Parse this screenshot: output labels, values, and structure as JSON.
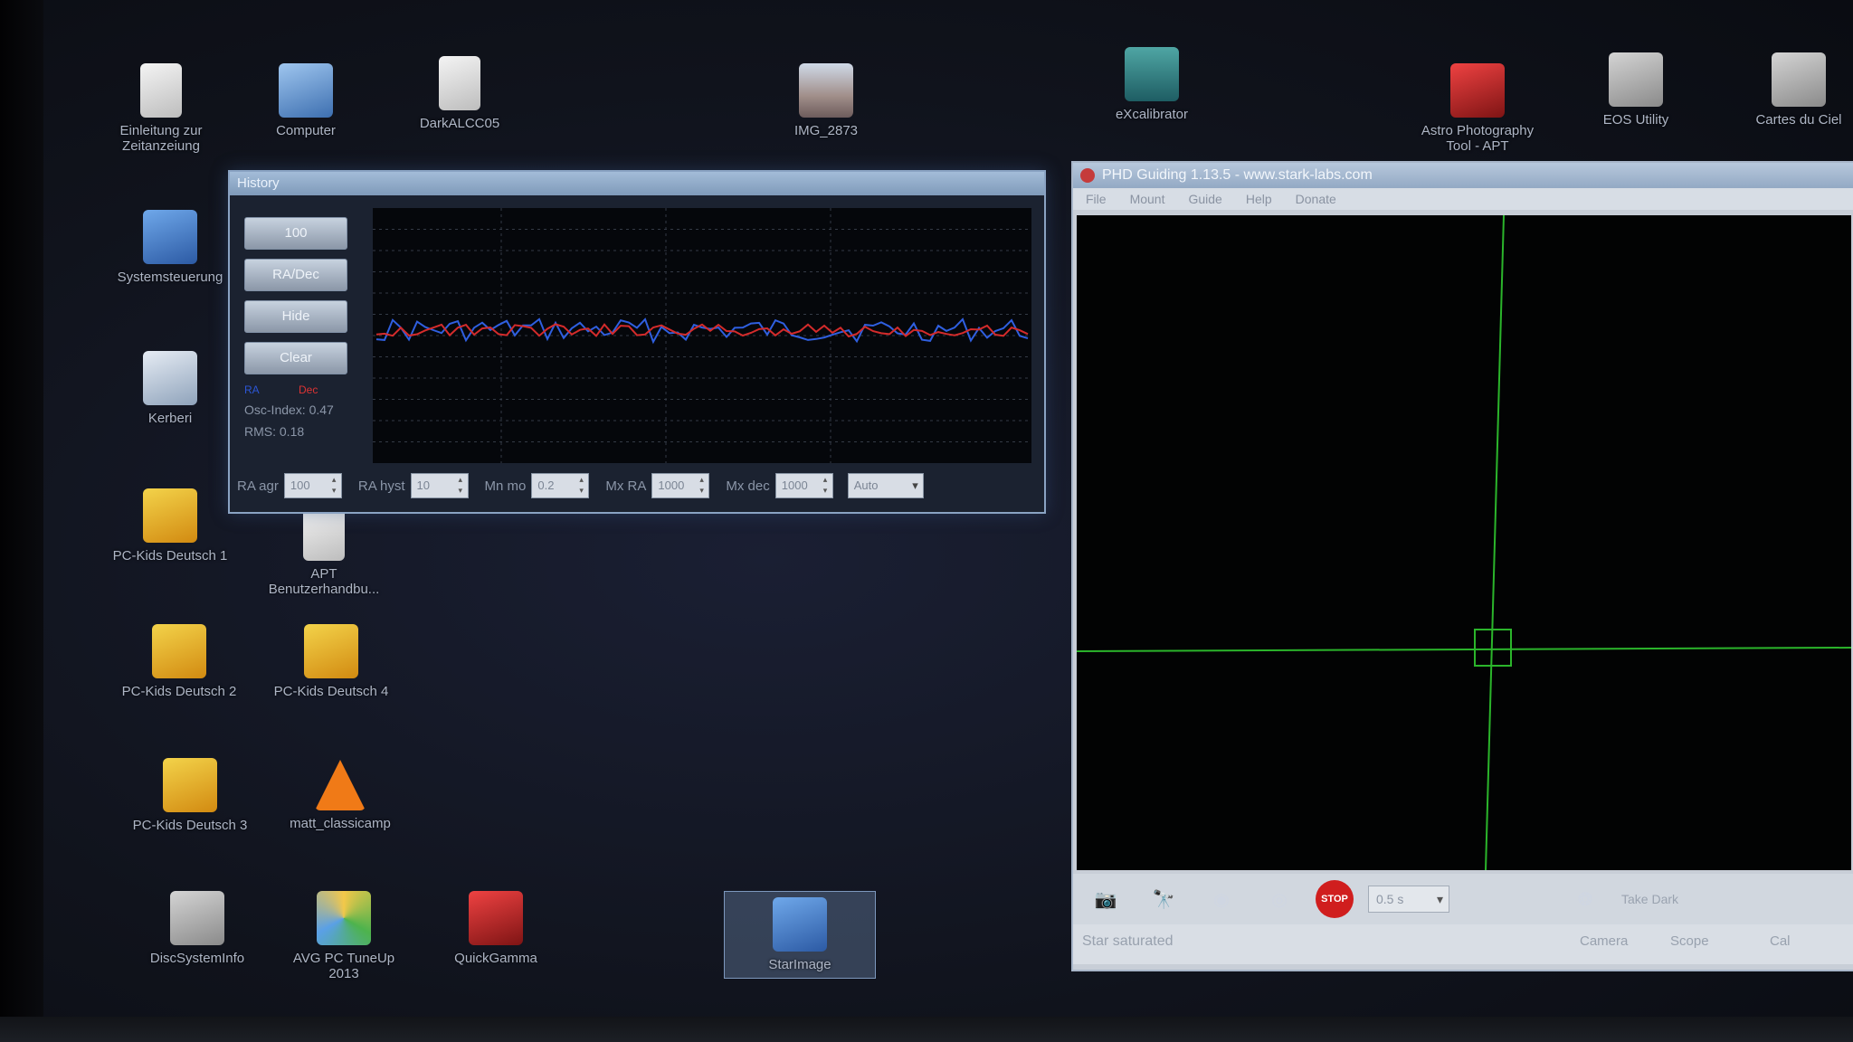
{
  "desktop": {
    "icons": [
      {
        "label": "Einleitung zur Zeitanzeiung",
        "glyph": "g-doc"
      },
      {
        "label": "Computer",
        "glyph": "g-pc"
      },
      {
        "label": "DarkALCC05",
        "glyph": "g-doc"
      },
      {
        "label": "IMG_2873",
        "glyph": "g-img"
      },
      {
        "label": "eXcalibrator",
        "glyph": "g-teal"
      },
      {
        "label": "Astro Photography Tool - APT",
        "glyph": "g-red"
      },
      {
        "label": "EOS Utility",
        "glyph": "g-gray"
      },
      {
        "label": "Cartes du Ciel",
        "glyph": "g-gray"
      },
      {
        "label": "Systemsteuerung",
        "glyph": "g-blue"
      },
      {
        "label": "Kerberi",
        "glyph": "g-jar"
      },
      {
        "label": "PC-Kids Deutsch 1",
        "glyph": "g-yellow"
      },
      {
        "label": "APT Benutzerhandbu...",
        "glyph": "g-doc"
      },
      {
        "label": "PC-Kids Deutsch 2",
        "glyph": "g-yellow"
      },
      {
        "label": "PC-Kids Deutsch 4",
        "glyph": "g-yellow"
      },
      {
        "label": "PC-Kids Deutsch 3",
        "glyph": "g-yellow"
      },
      {
        "label": "matt_classicamp",
        "glyph": "g-cone"
      },
      {
        "label": "DiscSystemInfo",
        "glyph": "g-gray"
      },
      {
        "label": "AVG PC TuneUp 2013",
        "glyph": "g-rgb"
      },
      {
        "label": "QuickGamma",
        "glyph": "g-red"
      },
      {
        "label": "StarImage",
        "glyph": "g-blue"
      }
    ]
  },
  "history": {
    "title": "History",
    "buttons": {
      "zoom": "100",
      "radec": "RA/Dec",
      "hide": "Hide",
      "clear": "Clear"
    },
    "legend": {
      "ra": "RA",
      "dec": "Dec"
    },
    "osc": "Osc-Index: 0.47",
    "rms": "RMS: 0.18",
    "controls": {
      "ra_agr_label": "RA agr",
      "ra_agr_value": "100",
      "ra_hyst_label": "RA hyst",
      "ra_hyst_value": "10",
      "mn_mo_label": "Mn mo",
      "mn_mo_value": "0.2",
      "mx_ra_label": "Mx RA",
      "mx_ra_value": "1000",
      "mx_dec_label": "Mx dec",
      "mx_dec_value": "1000",
      "dec_mode": "Auto"
    },
    "colors": {
      "ra": "#2f5fe0",
      "dec": "#d42b2b",
      "grid": "#343a46"
    }
  },
  "phd": {
    "title": "PHD Guiding 1.13.5  -  www.stark-labs.com",
    "menu": [
      "File",
      "Mount",
      "Guide",
      "Help",
      "Donate"
    ],
    "exposure": "0.5 s",
    "gain": "Take Dark",
    "status": "Star saturated",
    "indicators": [
      "Camera",
      "Scope",
      "Cal"
    ],
    "crosshair_color": "#2bb52b"
  }
}
